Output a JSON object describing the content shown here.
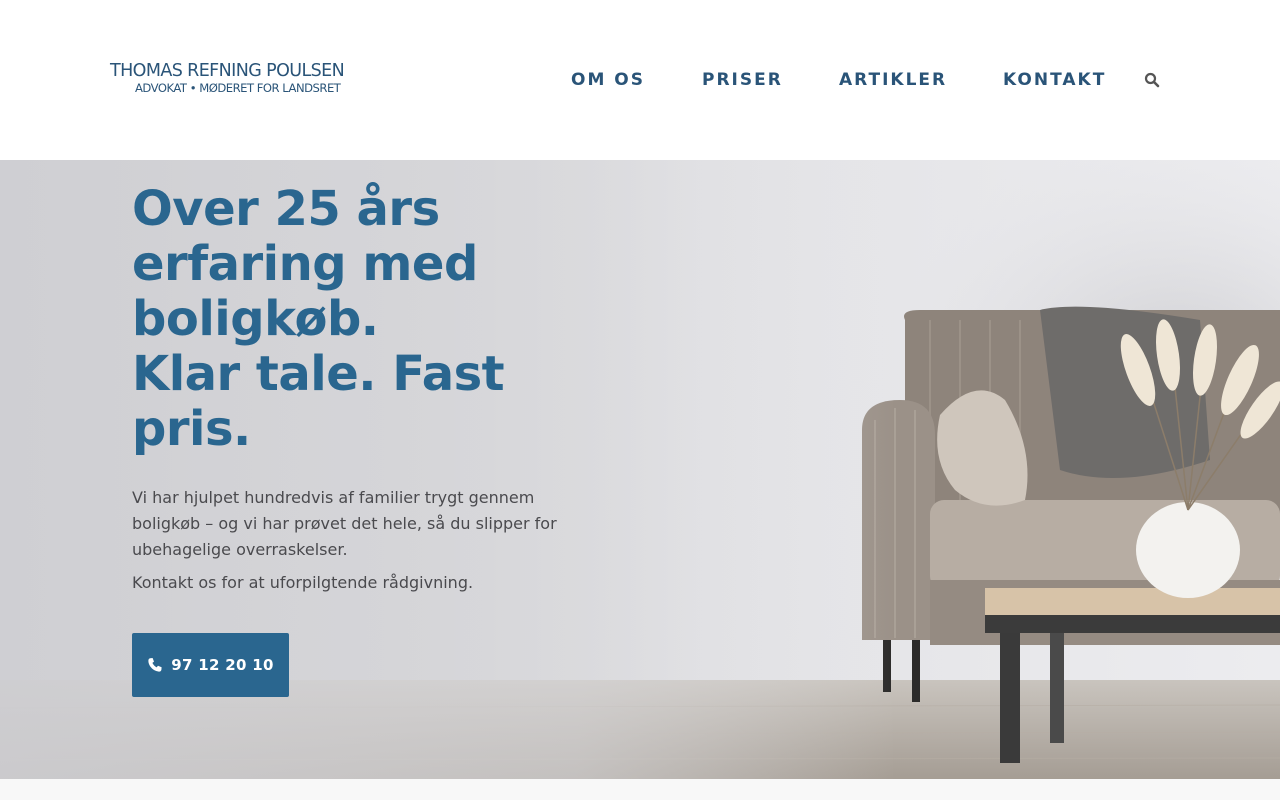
{
  "header": {
    "logo_name": "THOMAS REFNING POULSEN",
    "logo_sub": "ADVOKAT • MØDERET FOR LANDSRET",
    "nav": [
      {
        "label": "OM OS"
      },
      {
        "label": "PRISER"
      },
      {
        "label": "ARTIKLER"
      },
      {
        "label": "KONTAKT"
      }
    ],
    "search_icon": "search-icon"
  },
  "hero": {
    "headline_lines": [
      "Over 25 års",
      "erfaring med",
      "boligkøb.",
      "Klar tale. Fast",
      "pris."
    ],
    "lead": "Vi har hjulpet hundredvis af familier trygt gennem boligkøb – og vi har prøvet det hele, så du slipper for ubehagelige overraskelser.",
    "lead2": "Kontakt os for at uforpilgtende rådgivning.",
    "phone_button": {
      "label": "97 12 20 10",
      "icon": "phone-icon"
    }
  },
  "colors": {
    "brand_dark": "#2a5478",
    "brand_blue": "#2a668f",
    "body_text": "#4a4a4e"
  }
}
